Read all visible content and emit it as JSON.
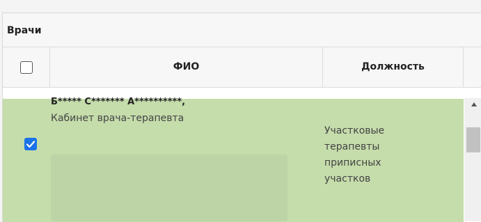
{
  "section": {
    "title": "Врачи"
  },
  "table": {
    "columns": {
      "name_header": "ФИО",
      "position_header": "Должность"
    },
    "rows": [
      {
        "selected": true,
        "doctor_name": "Б***** С******* А**********,",
        "room": "Кабинет врача-терапевта",
        "position_lines": [
          "Участковые",
          "терапевты",
          "приписных",
          "участков"
        ]
      }
    ]
  },
  "colors": {
    "selected_row": "#c5dcab",
    "checkbox_checked": "#1a73e8",
    "header_bg": "#f7f7f7"
  }
}
